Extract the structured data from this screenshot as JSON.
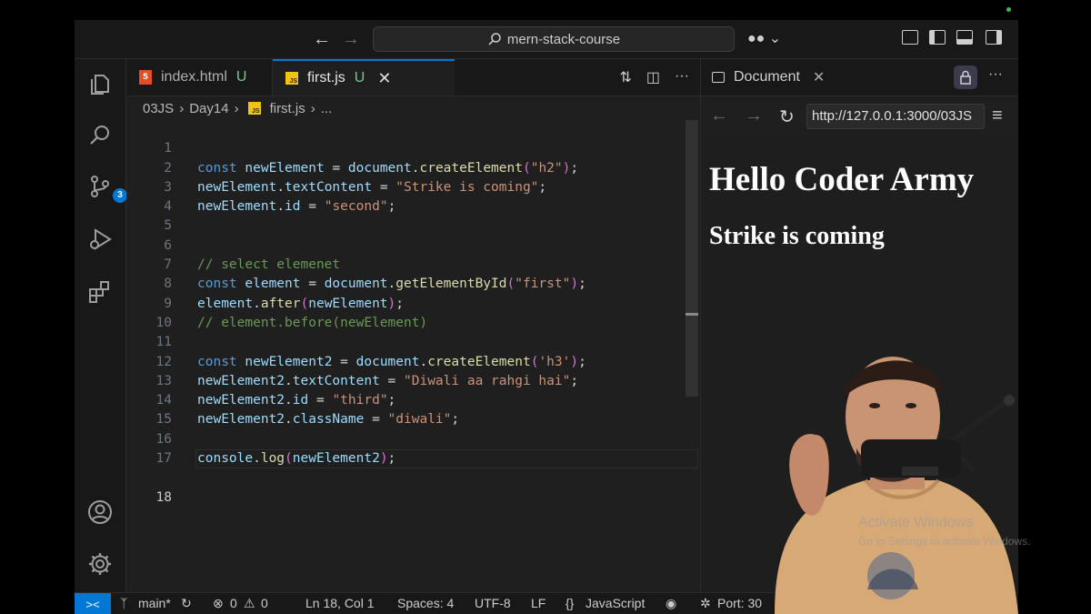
{
  "window": {
    "search_text": "mern-stack-course"
  },
  "activity": {
    "source_control_badge": "3"
  },
  "tabs": [
    {
      "icon": "html5",
      "name": "index.html",
      "status": "U"
    },
    {
      "icon": "js",
      "name": "first.js",
      "status": "U"
    }
  ],
  "breadcrumb": {
    "folder1": "03JS",
    "folder2": "Day14",
    "file": "first.js",
    "more": "..."
  },
  "code": {
    "line_numbers": [
      "1",
      "2",
      "3",
      "4",
      "5",
      "6",
      "7",
      "8",
      "9",
      "10",
      "11",
      "12",
      "13",
      "14",
      "15",
      "16",
      "17",
      "18"
    ],
    "current_line": "18"
  },
  "browser": {
    "tab_title": "Document",
    "url": "http://127.0.0.1:3000/03JS",
    "heading1": "Hello Coder Army",
    "heading2": "Strike is coming"
  },
  "watermark": {
    "line1": "Activate Windows",
    "line2": "Go to Settings to activate Windows."
  },
  "statusbar": {
    "branch": "main*",
    "errors": "0",
    "warnings": "0",
    "cursor": "Ln 18, Col 1",
    "spaces": "Spaces: 4",
    "encoding": "UTF-8",
    "eol": "LF",
    "language": "JavaScript",
    "port": "Port: 30"
  },
  "colors": {
    "accent": "#0078d4",
    "untracked": "#73c991",
    "keyword": "#569cd6",
    "string": "#ce9178",
    "comment": "#6a9955"
  }
}
